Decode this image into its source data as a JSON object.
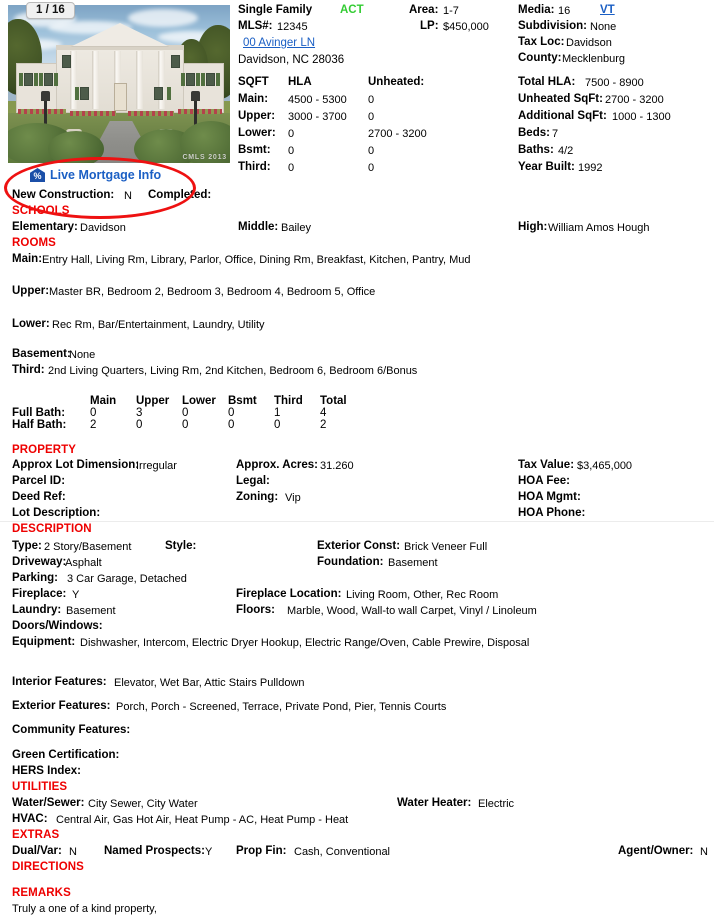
{
  "photo": {
    "counter": "1 / 16",
    "watermark": "CMLS 2013"
  },
  "mortgage": {
    "link_label": "Live Mortgage Info",
    "icon": "percent-house-icon"
  },
  "header": {
    "property_type": "Single Family",
    "status": "ACT",
    "status_color": "#33cc33",
    "mls_label": "MLS#:",
    "mls_value": "12345",
    "address_line1": "00 Avinger LN",
    "address_line2": "Davidson,  NC  28036",
    "area_label": "Area:",
    "area_value": "1-7",
    "lp_label": "LP:",
    "lp_value": "$450,000",
    "media_label": "Media:",
    "media_value": "16",
    "vt_label": "VT",
    "subdivision_label": "Subdivision:",
    "subdivision_value": "None",
    "tax_loc_label": "Tax Loc:",
    "tax_loc_value": "Davidson",
    "county_label": "County:",
    "county_value": "Mecklenburg"
  },
  "sqft": {
    "col_sqft": "SQFT",
    "col_hla": "HLA",
    "col_unheated": "Unheated:",
    "rows": [
      {
        "label": "Main:",
        "hla": "4500 - 5300",
        "unheated": "0"
      },
      {
        "label": "Upper:",
        "hla": "3000 - 3700",
        "unheated": "0"
      },
      {
        "label": "Lower:",
        "hla": "0",
        "unheated": "2700 - 3200"
      },
      {
        "label": "Bsmt:",
        "hla": "0",
        "unheated": "0"
      },
      {
        "label": "Third:",
        "hla": "0",
        "unheated": "0"
      }
    ],
    "totals": [
      {
        "label": "Total HLA:",
        "value": "7500 - 8900"
      },
      {
        "label": "Unheated SqFt:",
        "value": "2700 - 3200"
      },
      {
        "label": "Additional SqFt:",
        "value": "1000 - 1300"
      },
      {
        "label": "Beds:",
        "value": "7"
      },
      {
        "label": "Baths:",
        "value": "4/2"
      },
      {
        "label": "Year Built:",
        "value": "1992"
      }
    ]
  },
  "construction": {
    "new_construction_label": "New Construction:",
    "new_construction_value": "N",
    "completed_label": "Completed:",
    "completed_value": ""
  },
  "schools": {
    "section": "SCHOOLS",
    "elementary_label": "Elementary:",
    "elementary_value": "Davidson",
    "middle_label": "Middle:",
    "middle_value": "Bailey",
    "high_label": "High:",
    "high_value": "William Amos Hough"
  },
  "rooms": {
    "section": "ROOMS",
    "main_label": "Main:",
    "main_value": "Entry Hall, Living Rm, Library, Parlor, Office, Dining Rm, Breakfast, Kitchen, Pantry, Mud",
    "upper_label": "Upper:",
    "upper_value": "Master BR, Bedroom 2, Bedroom 3, Bedroom 4, Bedroom 5, Office",
    "lower_label": "Lower:",
    "lower_value": "Rec Rm, Bar/Entertainment, Laundry, Utility",
    "basement_label": "Basement:",
    "basement_value": "None",
    "third_label": "Third:",
    "third_value": "2nd Living Quarters, Living Rm, 2nd Kitchen, Bedroom 6, Bedroom 6/Bonus"
  },
  "baths": {
    "columns": [
      "Main",
      "Upper",
      "Lower",
      "Bsmt",
      "Third",
      "Total"
    ],
    "rows": [
      {
        "label": "Full Bath:",
        "values": [
          "0",
          "3",
          "0",
          "0",
          "1",
          "4"
        ]
      },
      {
        "label": "Half Bath:",
        "values": [
          "2",
          "0",
          "0",
          "0",
          "0",
          "2"
        ]
      }
    ]
  },
  "property": {
    "section": "PROPERTY",
    "lot_dimension_label": "Approx Lot Dimension:",
    "lot_dimension_value": "Irregular",
    "parcel_id_label": "Parcel ID:",
    "parcel_id_value": "",
    "deed_ref_label": "Deed Ref:",
    "deed_ref_value": "",
    "lot_description_label": "Lot Description:",
    "lot_description_value": "",
    "acres_label": "Approx. Acres:",
    "acres_value": "31.260",
    "legal_label": "Legal:",
    "legal_value": "",
    "zoning_label": "Zoning:",
    "zoning_value": "Vip",
    "tax_value_label": "Tax Value:",
    "tax_value_value": "$3,465,000",
    "hoa_fee_label": "HOA Fee:",
    "hoa_fee_value": "",
    "hoa_mgmt_label": "HOA Mgmt:",
    "hoa_mgmt_value": "",
    "hoa_phone_label": "HOA Phone:",
    "hoa_phone_value": ""
  },
  "description": {
    "section": "DESCRIPTION",
    "type_label": "Type:",
    "type_value": "2 Story/Basement",
    "style_label": "Style:",
    "style_value": "",
    "exterior_const_label": "Exterior Const:",
    "exterior_const_value": "Brick Veneer Full",
    "driveway_label": "Driveway:",
    "driveway_value": "Asphalt",
    "foundation_label": "Foundation:",
    "foundation_value": "Basement",
    "parking_label": "Parking:",
    "parking_value": "3 Car Garage, Detached",
    "fireplace_label": "Fireplace:",
    "fireplace_value": "Y",
    "fireplace_location_label": "Fireplace Location:",
    "fireplace_location_value": "Living Room, Other, Rec Room",
    "laundry_label": "Laundry:",
    "laundry_value": "Basement",
    "floors_label": "Floors:",
    "floors_value": "Marble, Wood, Wall-to wall Carpet, Vinyl / Linoleum",
    "doors_windows_label": "Doors/Windows:",
    "doors_windows_value": "",
    "equipment_label": "Equipment:",
    "equipment_value": "Dishwasher, Intercom, Electric Dryer Hookup, Electric Range/Oven, Cable Prewire, Disposal"
  },
  "features": {
    "interior_label": "Interior Features:",
    "interior_value": "Elevator, Wet Bar, Attic Stairs Pulldown",
    "exterior_label": "Exterior Features:",
    "exterior_value": "Porch, Porch - Screened, Terrace, Private Pond, Pier, Tennis Courts",
    "community_label": "Community Features:",
    "community_value": "",
    "green_cert_label": "Green Certification:",
    "green_cert_value": "",
    "hers_label": "HERS Index:",
    "hers_value": ""
  },
  "utilities": {
    "section": "UTILITIES",
    "water_sewer_label": "Water/Sewer:",
    "water_sewer_value": "City Sewer, City Water",
    "water_heater_label": "Water Heater:",
    "water_heater_value": "Electric",
    "hvac_label": "HVAC:",
    "hvac_value": "Central Air, Gas Hot Air, Heat Pump - AC, Heat Pump - Heat"
  },
  "extras": {
    "section": "EXTRAS",
    "dual_var_label": "Dual/Var:",
    "dual_var_value": "N",
    "named_prospects_label": "Named Prospects:",
    "named_prospects_value": "Y",
    "prop_fin_label": "Prop Fin:",
    "prop_fin_value": "Cash, Conventional",
    "agent_owner_label": "Agent/Owner:",
    "agent_owner_value": "N"
  },
  "directions": {
    "section": "DIRECTIONS",
    "text": ""
  },
  "remarks": {
    "section": "REMARKS",
    "text": "Truly a one of a kind property,"
  }
}
